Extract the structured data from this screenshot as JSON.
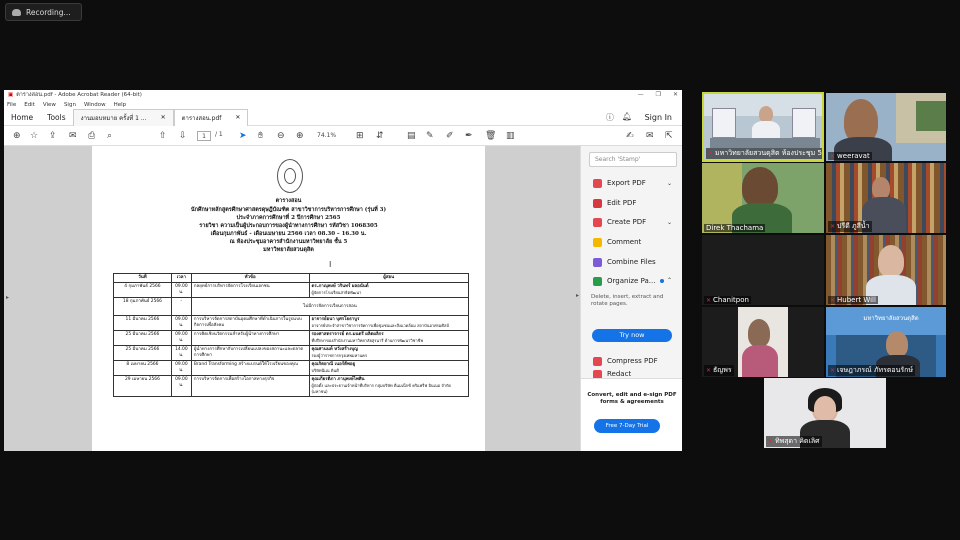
{
  "recording": {
    "label": "Recording..."
  },
  "acrobat": {
    "window_title": "ตารางสอน.pdf - Adobe Acrobat Reader (64-bit)",
    "menu": [
      "File",
      "Edit",
      "View",
      "Sign",
      "Window",
      "Help"
    ],
    "tabs": {
      "home": "Home",
      "tools": "Tools",
      "doc1": "งานมอบหมาย ครั้งที่ 1 ...",
      "doc2": "ตารางสอน.pdf"
    },
    "signin": "Sign In",
    "page_current": "1",
    "page_total": "/ 1",
    "zoom": "74.1%",
    "document": {
      "title": "ตารางสอน",
      "lines": [
        "นักศึกษาหลักสูตรศึกษาศาสตรดุษฎีบัณฑิต สาขาวิชาการบริหารการศึกษา (รุ่นที่ 3)",
        "ประจำภาคการศึกษาที่ 2 ปีการศึกษา 2565",
        "รายวิชา ความเป็นผู้ประกอบการของผู้นำทางการศึกษา รหัสวิชา 1068305",
        "เดือนกุมภาพันธ์ - เดือนเมษายน 2566 เวลา 08.30 – 16.30 น.",
        "ณ ห้องประชุมอาคารสำนักงานมหาวิทยาลัย ชั้น 5",
        "มหาวิทยาลัยสวนดุสิต"
      ],
      "columns": [
        "วันที่",
        "เวลา",
        "หัวข้อ",
        "ผู้สอน"
      ],
      "rows": [
        {
          "date": "4 กุมภาพันธ์ 2566",
          "time": "09.00 น.",
          "topic": "กลยุทธ์การบริหารจัดการโรงเรียนเอกชน",
          "teacher": "ดร.ภาณุพงษ์ วรินทร์ ผลอนันต์",
          "teacher_sub": "ผู้จัดการโรงเรียนสาธิตพัฒนา"
        },
        {
          "date": "18 กุมภาพันธ์ 2566",
          "time": "-",
          "topic": "ไม่มีการจัดการเรียนการสอน",
          "teacher": "",
          "teacher_sub": ""
        },
        {
          "date": "11 มีนาคม 2566",
          "time": "09.00 น.",
          "topic": "การบริหารจัดการสถาบันอุดมศึกษาที่ดำเนินการในรูปแบบกิจการเพื่อสังคม",
          "teacher": "อาจารย์อนา บุศรโยธาบูร",
          "teacher_sub": "อาจารย์ประจำสาขาวิชาการจัดการเพื่อชุมชนและสิ่งแวดล้อม สถาบันอาศรมศิลป์"
        },
        {
          "date": "25 มีนาคม 2566",
          "time": "09.00 น.",
          "topic": "การคิดเชิงนวัตกรรมสำหรับผู้นำทางการศึกษา",
          "teacher": "รองศาสตราจารย์ ดร.มนตรี ผลิตผลิกร",
          "teacher_sub": "ที่ปรึกษาของสำนักงานมหาวิทยาลัยสุรนารี ด้านการพัฒนาวิชาชีพ"
        },
        {
          "date": "25 มีนาคม 2566",
          "time": "14.00 น.",
          "topic": "ผู้นำทางการศึกษากับการเปลี่ยนแปลงของสถานะและตลาดการศึกษา",
          "teacher": "คุณศานนท์ หวังสร้างบุญ",
          "teacher_sub": "รองผู้ว่าราชการกรุงเทพมหานคร"
        },
        {
          "date": "8 เมษายน 2566",
          "time": "09.00 น.",
          "topic": "Brand Transforming สร้างแบรนด์ให้โรงเรียนของคุณ",
          "teacher": "คุณกิตยาณี เนอร์ดีพอยู",
          "teacher_sub": "บริษัทนีเเน ดินดี"
        },
        {
          "date": "29 เมษายน 2566",
          "time": "09.00 น.",
          "topic": "การบริหารจัดการเพื่อสร้างโอกาสทางธุรกิจ",
          "teacher": "คุณเกียรติภา ภานุพงษ์ไพศิน",
          "teacher_sub": "ผู้ก่อตั้ง และประธานเจ้าหน้าที่บริหาร กลุ่มบริษัท ดีแมเน็กซ์ คริแพรีฟ อินเนอ จำกัด (มหาชน)"
        }
      ]
    },
    "sidebar": {
      "search_placeholder": "Search 'Stamp'",
      "tools": [
        "Export PDF",
        "Edit PDF",
        "Create PDF",
        "Comment",
        "Combine Files",
        "Organize Pa..."
      ],
      "organize_desc": "Delete, insert, extract and rotate pages.",
      "try_now": "Try now",
      "tools_more": [
        "Compress PDF",
        "Redact"
      ],
      "promo_text": "Convert, edit and e-sign PDF forms & agreements",
      "promo_button": "Free 7-Day Trial"
    }
  },
  "participants": [
    {
      "name": "มหาวิทยาลัยสวนดุสิต ห้องประชุม 5"
    },
    {
      "name": "weeravat"
    },
    {
      "name": "Direk Thachama"
    },
    {
      "name": "ปรีดี ภูสีน้ำ"
    },
    {
      "name": "Chanitpon"
    },
    {
      "name": "Hubert Will"
    },
    {
      "name": "ธัญพร"
    },
    {
      "name": "เจษฎาภรณ์ ภัทรตอนรักษ์"
    },
    {
      "name": "ทิพสุดา คิดเลิศ"
    }
  ],
  "colors": {
    "active_speaker_border": "#c8d83a",
    "acrobat_accent": "#1473e6",
    "viewer_bg": "#cfcfcf"
  }
}
